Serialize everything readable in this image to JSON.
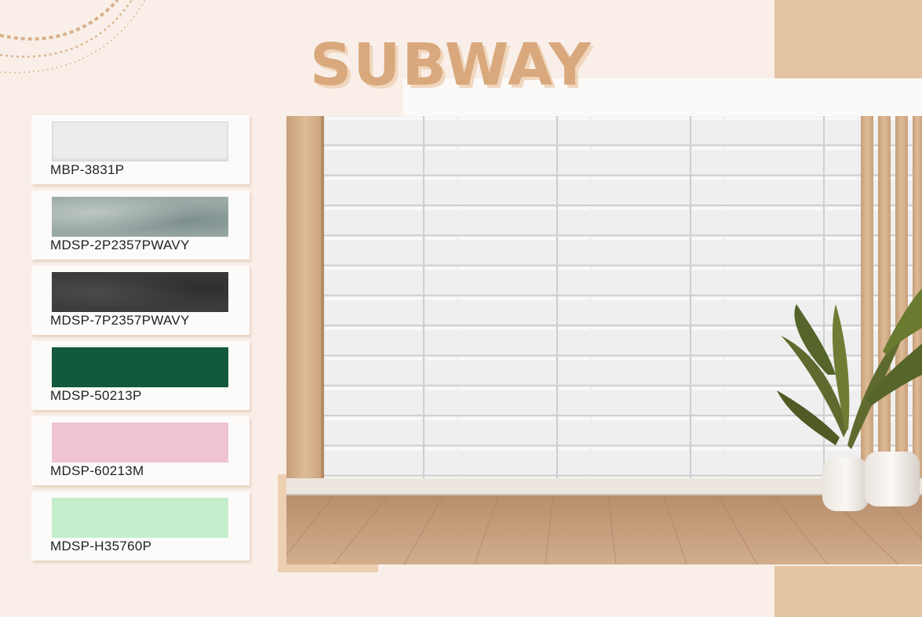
{
  "title": "SUBWAY",
  "colors": {
    "background": "#f9efe8",
    "accent_block": "#e5c4a3",
    "title": "#d9a87d",
    "title_shadow": "#f0d6bd"
  },
  "swatches": [
    {
      "code": "MBP-3831P",
      "color": "#ececec",
      "finish": "plain"
    },
    {
      "code": "MDSP-2P2357PWAVY",
      "color": "#9aa9a6",
      "finish": "wavy"
    },
    {
      "code": "MDSP-7P2357PWAVY",
      "color": "#3b3d3b",
      "finish": "wavy"
    },
    {
      "code": "MDSP-50213P",
      "color": "#135a3d",
      "finish": "plain"
    },
    {
      "code": "MDSP-60213M",
      "color": "#f0c3d1",
      "finish": "matte"
    },
    {
      "code": "MDSP-H35760P",
      "color": "#c3efcc",
      "finish": "plain"
    }
  ],
  "room_scene": {
    "wall_tile_color": "#efefef",
    "grout_color": "#cfcfcf",
    "floor_color": "#c29c7a",
    "wood_color": "#d5b08b",
    "plant_icon": "potted-plant-icon"
  }
}
